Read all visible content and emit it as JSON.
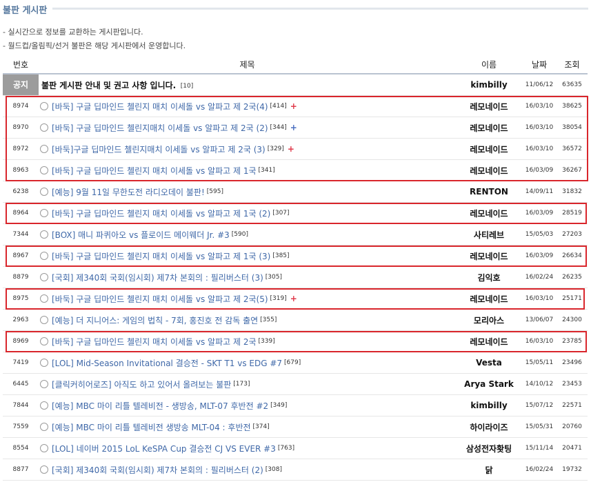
{
  "board": {
    "title": "불판 게시판",
    "desc_1": "- 실시간으로 정보를 교환하는 게시판입니다.",
    "desc_2": "- 월드컵/올림픽/선거 불판은 해당 게시판에서 운영합니다."
  },
  "columns": {
    "num": "번호",
    "title": "제목",
    "name": "이름",
    "date": "날짜",
    "views": "조회"
  },
  "notice": {
    "badge": "공지",
    "title": "불판 게시판 안내 및 권고 사항 입니다.",
    "comments": "[10]",
    "author": "kimbilly",
    "date": "11/06/12",
    "views": "63635"
  },
  "posts": [
    {
      "num": "8974",
      "title": "[바둑] 구글 딥마인드 첼린지 매치 이세돌 vs 알파고 제 2국(4)",
      "comments": "[414]",
      "mark": "+",
      "author": "레모네이드",
      "date": "16/03/10",
      "views": "38625"
    },
    {
      "num": "8970",
      "title": "[바둑] 구글 딥마인드 첼린지매치 이세돌 vs 알파고 제 2국 (2)",
      "comments": "[344]",
      "mark": "+",
      "author": "레모네이드",
      "date": "16/03/10",
      "views": "38054"
    },
    {
      "num": "8972",
      "title": "[바둑]구글 딥마인드 첼린지매치 이세돌 vs 알파고 제 2국 (3)",
      "comments": "[329]",
      "mark": "+",
      "author": "레모네이드",
      "date": "16/03/10",
      "views": "36572"
    },
    {
      "num": "8963",
      "title": "[바둑] 구글 딥마인드 첼린지 매치 이세돌 vs 알파고 제 1국",
      "comments": "[341]",
      "mark": "",
      "author": "레모네이드",
      "date": "16/03/09",
      "views": "36267"
    },
    {
      "num": "6238",
      "title": "[예능] 9월 11일 무한도전 라디오데이 불판!",
      "comments": "[595]",
      "mark": "",
      "author": "RENTON",
      "date": "14/09/11",
      "views": "31832"
    },
    {
      "num": "8964",
      "title": "[바둑] 구글 딥마인드 첼린지 매치 이세돌 vs 알파고 제 1국 (2)",
      "comments": "[307]",
      "mark": "",
      "author": "레모네이드",
      "date": "16/03/09",
      "views": "28519"
    },
    {
      "num": "7344",
      "title": "[BOX] 매니 파퀴아오 vs 플로이드 메이웨더 Jr. #3",
      "comments": "[590]",
      "mark": "",
      "author": "사티레브",
      "date": "15/05/03",
      "views": "27203"
    },
    {
      "num": "8967",
      "title": "[바둑] 구글 딥마인드 첼린지 매치 이세돌 vs 알파고 제 1국 (3)",
      "comments": "[385]",
      "mark": "",
      "author": "레모네이드",
      "date": "16/03/09",
      "views": "26634"
    },
    {
      "num": "8879",
      "title": "[국회] 제340회 국회(임시회) 제7차 본회의 : 필리버스터 (3)",
      "comments": "[305]",
      "mark": "",
      "author": "김익호",
      "date": "16/02/24",
      "views": "26235"
    },
    {
      "num": "8975",
      "title": "[바둑] 구글 딥마인드 첼린지 매치 이세돌 vs 알파고 제 2국(5)",
      "comments": "[319]",
      "mark": "+",
      "author": "레모네이드",
      "date": "16/03/10",
      "views": "25171"
    },
    {
      "num": "2963",
      "title": "[예능] 더 지니어스: 게임의 법칙 - 7회, 홍진호 전 감독 출연",
      "comments": "[355]",
      "mark": "",
      "author": "모리아스",
      "date": "13/06/07",
      "views": "24300"
    },
    {
      "num": "8969",
      "title": "[바둑] 구글 딥마인드 첼린지 매치 이세돌 vs 알파고 제 2국",
      "comments": "[339]",
      "mark": "",
      "author": "레모네이드",
      "date": "16/03/10",
      "views": "23785"
    },
    {
      "num": "7419",
      "title": "[LOL] Mid-Season Invitational 결승전 - SKT T1 vs EDG #7",
      "comments": "[679]",
      "mark": "",
      "author": "Vesta",
      "date": "15/05/11",
      "views": "23496"
    },
    {
      "num": "6445",
      "title": "[클릭커히어로즈] 아직도 하고 있어서 올려보는 불판",
      "comments": "[173]",
      "mark": "",
      "author": "Arya Stark",
      "date": "14/10/12",
      "views": "23453"
    },
    {
      "num": "7844",
      "title": "[예능] MBC 마이 리틀 텔레비전 - 생방송, MLT-07 후반전 #2",
      "comments": "[349]",
      "mark": "",
      "author": "kimbilly",
      "date": "15/07/12",
      "views": "22571"
    },
    {
      "num": "7559",
      "title": "[예능] MBC 마이 리틀 텔레비전 생방송 MLT-04 : 후반전",
      "comments": "[374]",
      "mark": "",
      "author": "하이라이즈",
      "date": "15/05/31",
      "views": "20760"
    },
    {
      "num": "8554",
      "title": "[LOL] 네이버 2015 LoL KeSPA Cup 결승전 CJ VS EVER #3",
      "comments": "[763]",
      "mark": "",
      "author": "삼성전자홧팅",
      "date": "15/11/14",
      "views": "20471"
    },
    {
      "num": "8877",
      "title": "[국회] 제340회 국회(임시회) 제7차 본회의 : 필리버스터 (2)",
      "comments": "[308]",
      "mark": "",
      "author": "닭",
      "date": "16/02/24",
      "views": "19732"
    }
  ],
  "colors": {
    "link": "#3f68a8",
    "highlight_box": "#d9252b",
    "plus_red": "#e0394a",
    "plus_blue": "#4a6fc0",
    "notice_badge": "#9c9c9c"
  }
}
